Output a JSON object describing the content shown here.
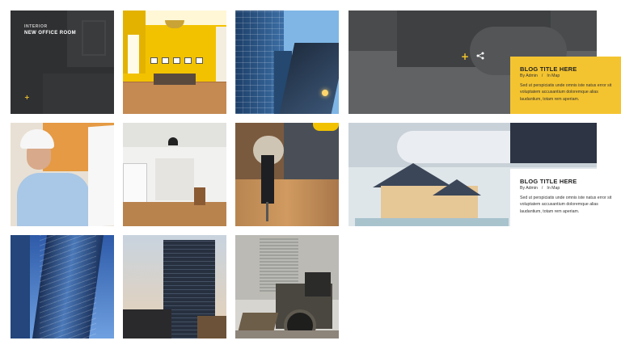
{
  "tiles": {
    "t1": {
      "category": "INTERIOR",
      "title": "NEW OFFICE ROOM"
    }
  },
  "posts": [
    {
      "title": "BLOG TITLE HERE",
      "author": "By Admin",
      "separator": "/",
      "location": "In Map",
      "excerpt": "Sed ut perspiciatis unde omnis iste natus error sit voluptatem accusantium doloremque alias laudantium, totam rem aperiam."
    },
    {
      "title": "BLOG TITLE HERE",
      "author": "By Admin",
      "separator": "/",
      "location": "In Map",
      "excerpt": "Sed ut perspiciatis unde omnis iste natus error sit voluptatem accusantium doloremque alias laudantium, totam rem aperiam."
    }
  ],
  "icons": {
    "plus": "+",
    "share": "share-icon"
  },
  "colors": {
    "accent": "#f4c430",
    "dark_overlay": "#2f3032"
  }
}
